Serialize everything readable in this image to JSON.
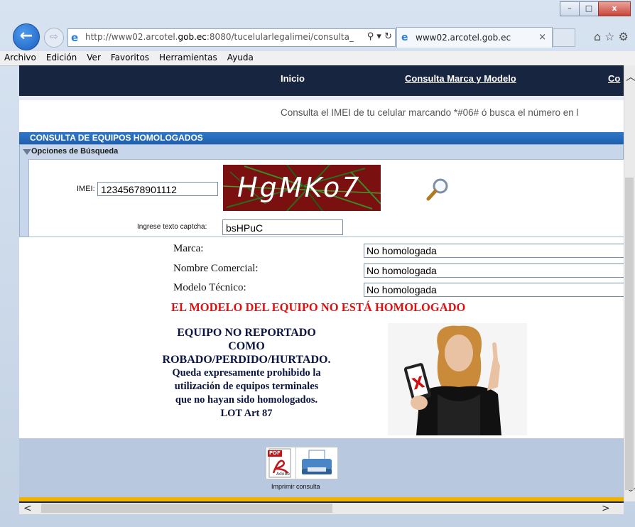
{
  "window": {
    "minimize": "–",
    "maximize": "□",
    "close": "x"
  },
  "toolbar": {
    "back_glyph": "←",
    "forward_glyph": "⇨",
    "address_prefix": "http://www02.arcotel.",
    "address_domain": "gob.ec",
    "address_suffix": ":8080/tucelularlegalimei/consulta_",
    "address_icons": "⚲ ▾ ↻",
    "tab_title": "www02.arcotel.gob.ec",
    "tab_close": "×",
    "tools_icons": "⌂☆⚙"
  },
  "menu": [
    "Archivo",
    "Edición",
    "Ver",
    "Favoritos",
    "Herramientas",
    "Ayuda"
  ],
  "site": {
    "nav": [
      "Inicio",
      "Consulta Marca y Modelo",
      "Co"
    ],
    "subtitle": "Consulta el IMEI de tu celular marcando *#06# ó busca el número en l",
    "panel_title": "CONSULTA DE EQUIPOS HOMOLOGADOS",
    "options_title": "Opciones de Búsqueda"
  },
  "form": {
    "imei_label": "IMEI:",
    "imei_value": "12345678901112",
    "captcha_text": "HgMKo7",
    "captcha_label": "Ingrese texto captcha:",
    "captcha_value": "bsHPuC"
  },
  "results": {
    "fields": [
      {
        "label": "Marca:",
        "value": "No homologada"
      },
      {
        "label": "Nombre Comercial:",
        "value": "No homologada"
      },
      {
        "label": "Modelo Técnico:",
        "value": "No homologada"
      }
    ],
    "warning": "EL MODELO DEL EQUIPO NO ESTÁ HOMOLOGADO",
    "report_lines": [
      "EQUIPO NO REPORTADO",
      "COMO",
      "ROBADO/PERDIDO/HURTADO."
    ],
    "notice_lines": [
      "Queda expresamente prohibido la",
      "utilización de equipos terminales",
      "que no hayan sido homologados.",
      "LOT Art 87"
    ]
  },
  "footer": {
    "print_label": "Imprimir consulta",
    "pdf_badge": "PDF",
    "pdf_brand": "Adobe"
  },
  "colors": {
    "nav_bg": "#182540",
    "panel_head": "#2f78c8",
    "warning": "#e01010",
    "gold": "#f0b400"
  }
}
